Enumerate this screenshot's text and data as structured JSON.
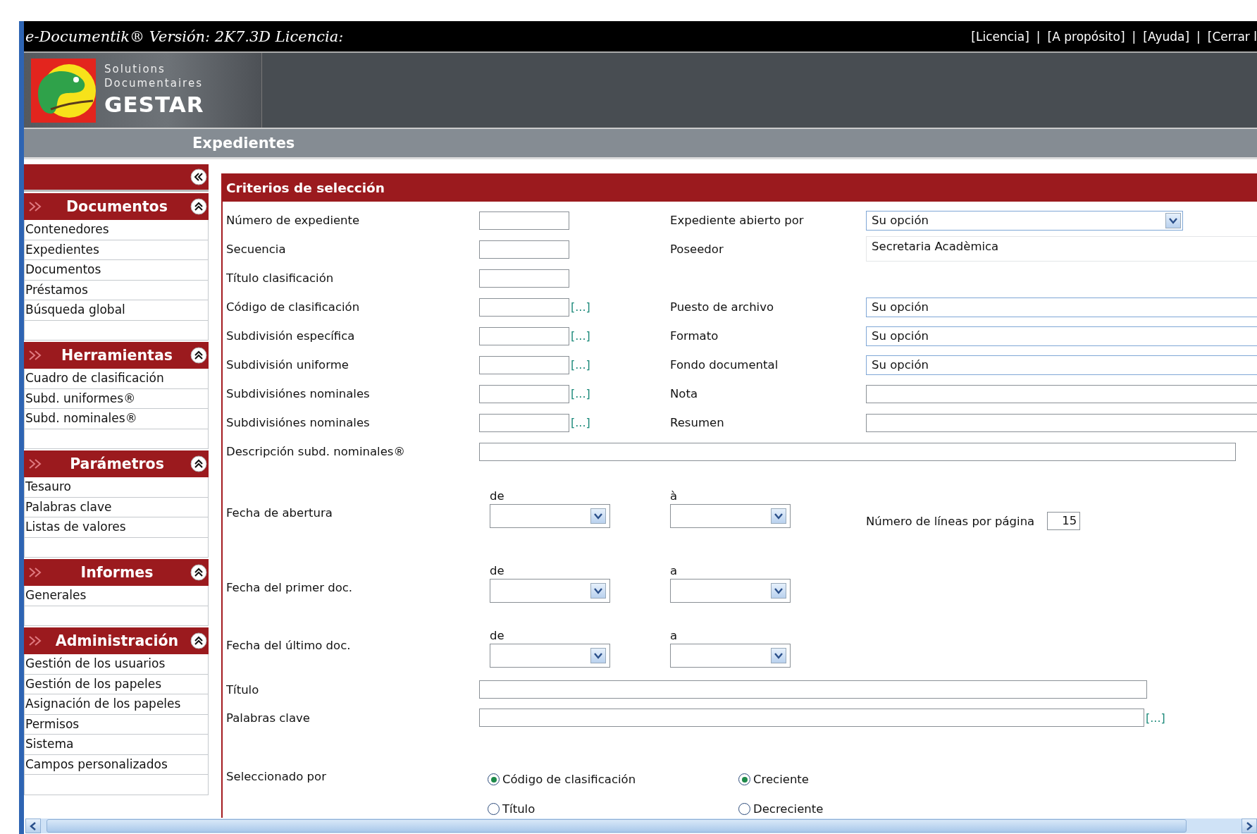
{
  "top_bar": {
    "title": "e-Documentik® Versión: 2K7.3D Licencia:",
    "separator": "|",
    "links": [
      "[Licencia]",
      "[A propósito]",
      "[Ayuda]",
      "[Cerrar l"
    ]
  },
  "logo": {
    "line1": "Solutions",
    "line2": "Documentaires",
    "name": "GESTAR"
  },
  "page_title": "Expedientes",
  "sidebar": {
    "sections": [
      {
        "title": "Documentos",
        "items": [
          "Contenedores",
          "Expedientes",
          "Documentos",
          "Préstamos",
          "Búsqueda global"
        ]
      },
      {
        "title": "Herramientas",
        "items": [
          "Cuadro de clasificación",
          "Subd. uniformes®",
          "Subd. nominales®"
        ]
      },
      {
        "title": "Parámetros",
        "items": [
          "Tesauro",
          "Palabras clave",
          "Listas de valores"
        ]
      },
      {
        "title": "Informes",
        "items": [
          "Generales"
        ]
      },
      {
        "title": "Administración",
        "items": [
          "Gestión de los usuarios",
          "Gestión de los papeles",
          "Asignación de los papeles",
          "Permisos",
          "Sistema",
          "Campos personalizados"
        ]
      }
    ]
  },
  "form": {
    "title": "Criterios de selección",
    "lookup": "[...]",
    "rows": [
      {
        "label": "Número de expediente",
        "kind": "text",
        "right": {
          "label": "Expediente abierto por",
          "kind": "select",
          "value": "Su opción"
        }
      },
      {
        "label": "Secuencia",
        "kind": "text",
        "right": {
          "label": "Poseedor",
          "kind": "readonly",
          "value": "Secretaria Acadèmica"
        }
      },
      {
        "label": "Título clasificación",
        "kind": "text"
      },
      {
        "label": "Código de clasificación",
        "kind": "lookup",
        "right": {
          "label": "Puesto de archivo",
          "kind": "select_wide",
          "value": "Su opción"
        }
      },
      {
        "label": "Subdivisión específica",
        "kind": "lookup",
        "right": {
          "label": "Formato",
          "kind": "select_wide",
          "value": "Su opción"
        }
      },
      {
        "label": "Subdivisión uniforme",
        "kind": "lookup",
        "right": {
          "label": "Fondo documental",
          "kind": "select_wide",
          "value": "Su opción"
        }
      },
      {
        "label": "Subdivisiónes nominales",
        "kind": "lookup",
        "right": {
          "label": "Nota",
          "kind": "text_wide"
        }
      },
      {
        "label": "Subdivisiónes nominales",
        "kind": "lookup",
        "right": {
          "label": "Resumen",
          "kind": "text_wide"
        }
      },
      {
        "label": "Descripción subd. nominales®",
        "kind": "full"
      }
    ],
    "dates": [
      {
        "label": "Fecha de abertura",
        "from": "de",
        "to": "à"
      },
      {
        "label": "Fecha del primer doc.",
        "from": "de",
        "to": "a"
      },
      {
        "label": "Fecha del último doc.",
        "from": "de",
        "to": "a"
      }
    ],
    "lines_per_page": {
      "label": "Número de líneas por página",
      "value": "15"
    },
    "title_field": {
      "label": "Título"
    },
    "keywords_field": {
      "label": "Palabras clave"
    },
    "sort": {
      "label": "Seleccionado por",
      "by": [
        {
          "label": "Código de clasificación",
          "selected": true
        },
        {
          "label": "Título",
          "selected": false
        }
      ],
      "order": [
        {
          "label": "Creciente",
          "selected": true
        },
        {
          "label": "Decreciente",
          "selected": false
        }
      ]
    }
  }
}
